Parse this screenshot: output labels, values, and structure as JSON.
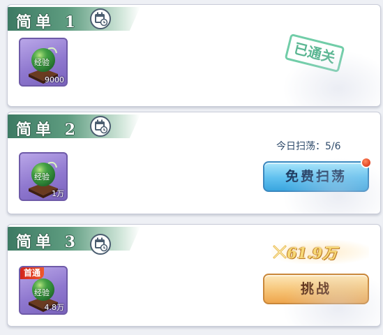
{
  "stages": [
    {
      "title": "简单 1",
      "reward": {
        "icon": "exp-orb-icon",
        "count": "9000"
      },
      "status": {
        "stamp": "已通关"
      }
    },
    {
      "title": "简单 2",
      "reward": {
        "icon": "exp-orb-icon",
        "count": "1万"
      },
      "sweep": {
        "label": "今日扫荡：5/6",
        "button": "免费扫荡",
        "has_red_dot": true
      }
    },
    {
      "title": "简单 3",
      "reward": {
        "icon": "exp-orb-icon",
        "count": "4.8万",
        "first_clear_tag": "首通"
      },
      "power": {
        "icon": "crossed-swords-icon",
        "value": "61.9万"
      },
      "challenge_button": "挑战"
    }
  ],
  "reward_item_label": "经验",
  "colors": {
    "ribbon": "#3d7a63",
    "blue_button": "#5fc0ef",
    "orange_button": "#f6c477",
    "stamp": "#59c59a",
    "reward_bg": "#8f78cf"
  }
}
